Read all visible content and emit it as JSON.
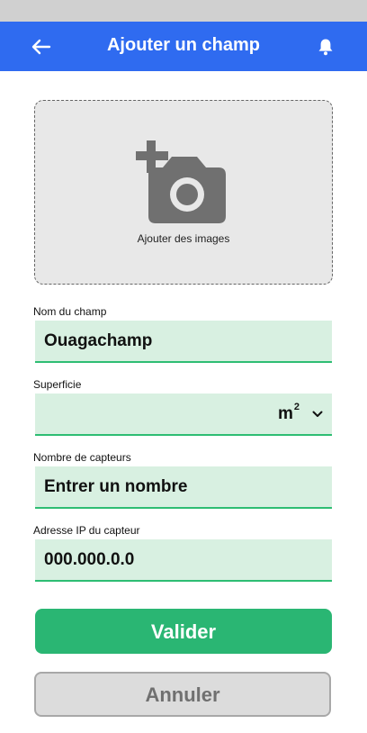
{
  "header": {
    "title": "Ajouter un champ",
    "back_icon": "arrow-left-icon",
    "bell_icon": "bell-icon",
    "color": "#2f6bf0"
  },
  "upload": {
    "label": "Ajouter des images",
    "icon": "add-photo-icon"
  },
  "form": {
    "name": {
      "label": "Nom du champ",
      "value": "Ouagachamp"
    },
    "area": {
      "label": "Superficie",
      "value": "",
      "unit": "m",
      "unit_exponent": "2",
      "dropdown_icon": "chevron-down-icon"
    },
    "sensors": {
      "label": "Nombre de capteurs",
      "placeholder": "Entrer un nombre"
    },
    "ip": {
      "label": "Adresse IP du capteur",
      "placeholder": "000.000.0.0"
    }
  },
  "actions": {
    "validate_label": "Valider",
    "cancel_label": "Annuler"
  },
  "colors": {
    "field_bg": "#d8f0e1",
    "accent_green": "#2ab673",
    "header_blue": "#2f6bf0"
  }
}
